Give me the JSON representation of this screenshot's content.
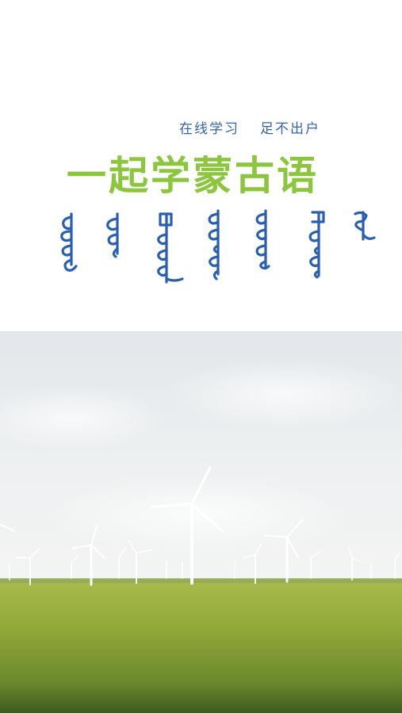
{
  "splash": {
    "tagline_left": "在线学习",
    "tagline_right": "足不出户",
    "headline": "一起学蒙古语",
    "mongolian_script_graphic": "mongolian-script-wordmark",
    "hero_image": "wind-turbines-on-grassland-photo"
  },
  "colors": {
    "headline_green": "#8cc63f",
    "tagline_blue": "#3563a8",
    "script_blue": "#2a5fb0",
    "sky": "#e9ecee",
    "grass": "#8aa23a"
  }
}
